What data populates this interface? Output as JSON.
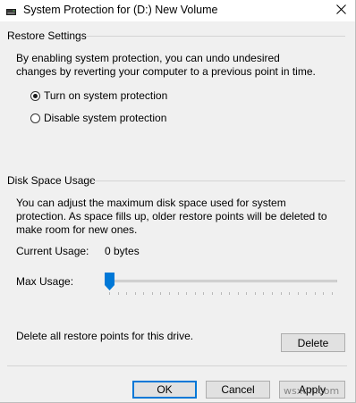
{
  "window": {
    "title": "System Protection for (D:) New Volume",
    "close_icon": "close-icon",
    "drive_icon": "drive-icon"
  },
  "restore_settings": {
    "heading": "Restore Settings",
    "description": "By enabling system protection, you can undo undesired changes by reverting your computer to a previous point in time.",
    "options": [
      {
        "label": "Turn on system protection",
        "checked": true
      },
      {
        "label": "Disable system protection",
        "checked": false
      }
    ]
  },
  "disk_space": {
    "heading": "Disk Space Usage",
    "description": "You can adjust the maximum disk space used for system protection. As space fills up, older restore points will be deleted to make room for new ones.",
    "current_usage_label": "Current Usage:",
    "current_usage_value": "0 bytes",
    "max_usage_label": "Max Usage:",
    "max_usage_fraction": 0,
    "delete_text": "Delete all restore points for this drive.",
    "delete_button": "Delete"
  },
  "footer": {
    "ok": "OK",
    "cancel": "Cancel",
    "apply": "Apply"
  },
  "watermark": "wsxdn.com",
  "colors": {
    "accent": "#0078d7",
    "dialog_bg": "#f0f0f0",
    "button_bg": "#e1e1e1"
  }
}
